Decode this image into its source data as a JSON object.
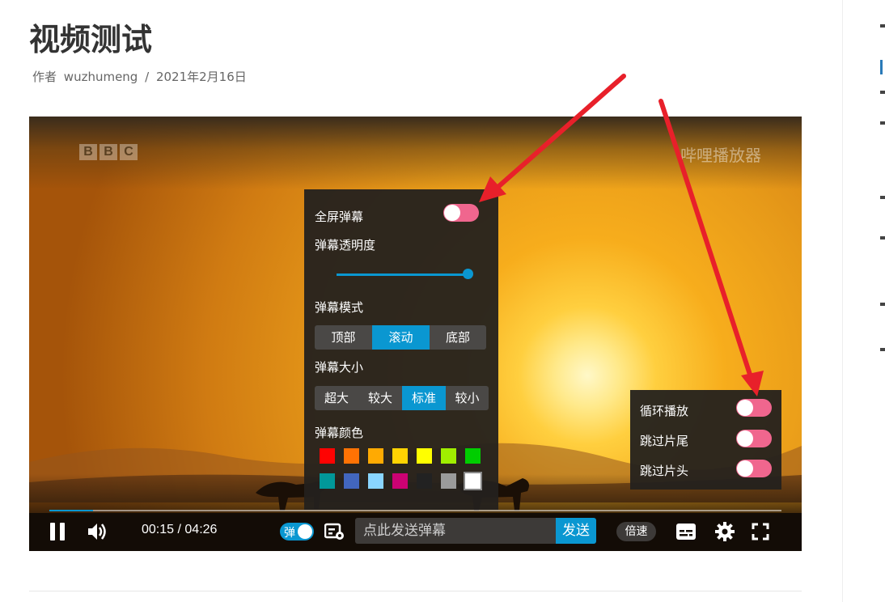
{
  "post": {
    "title": "视频测试",
    "author_prefix": "作者",
    "author": "wuzhumeng",
    "separator": "/",
    "date": "2021年2月16日"
  },
  "player": {
    "channel_logo": [
      "B",
      "B",
      "C"
    ],
    "watermark": "哔哩播放器",
    "danmaku_settings": {
      "fullscreen_label": "全屏弹幕",
      "opacity_label": "弹幕透明度",
      "opacity_value": 1.0,
      "mode_label": "弹幕模式",
      "modes": [
        "顶部",
        "滚动",
        "底部"
      ],
      "active_mode": "滚动",
      "size_label": "弹幕大小",
      "sizes": [
        "超大",
        "较大",
        "标准",
        "较小"
      ],
      "active_size": "标准",
      "color_label": "弹幕颜色",
      "colors": [
        "#fe0302",
        "#ff7204",
        "#ffaa02",
        "#ffd302",
        "#ffff00",
        "#a0ee00",
        "#00cd00",
        "#019899",
        "#4266be",
        "#89d5ff",
        "#cc0273",
        "#222222",
        "#9b9b9b",
        "#ffffff"
      ],
      "selected_color": "#ffffff"
    },
    "loop_menu": {
      "items": [
        "循环播放",
        "跳过片尾",
        "跳过片头"
      ]
    },
    "controls": {
      "progress": 0.06,
      "time_current": "00:15",
      "time_separator": "/",
      "time_total": "04:26",
      "danmaku_toggle_label": "弹",
      "danmaku_placeholder": "点此发送弹幕",
      "send_label": "发送",
      "speed_label": "倍速"
    }
  },
  "colors": {
    "accent": "#0a97d1",
    "toggle": "#f0668e",
    "arrow": "#e8202a"
  }
}
